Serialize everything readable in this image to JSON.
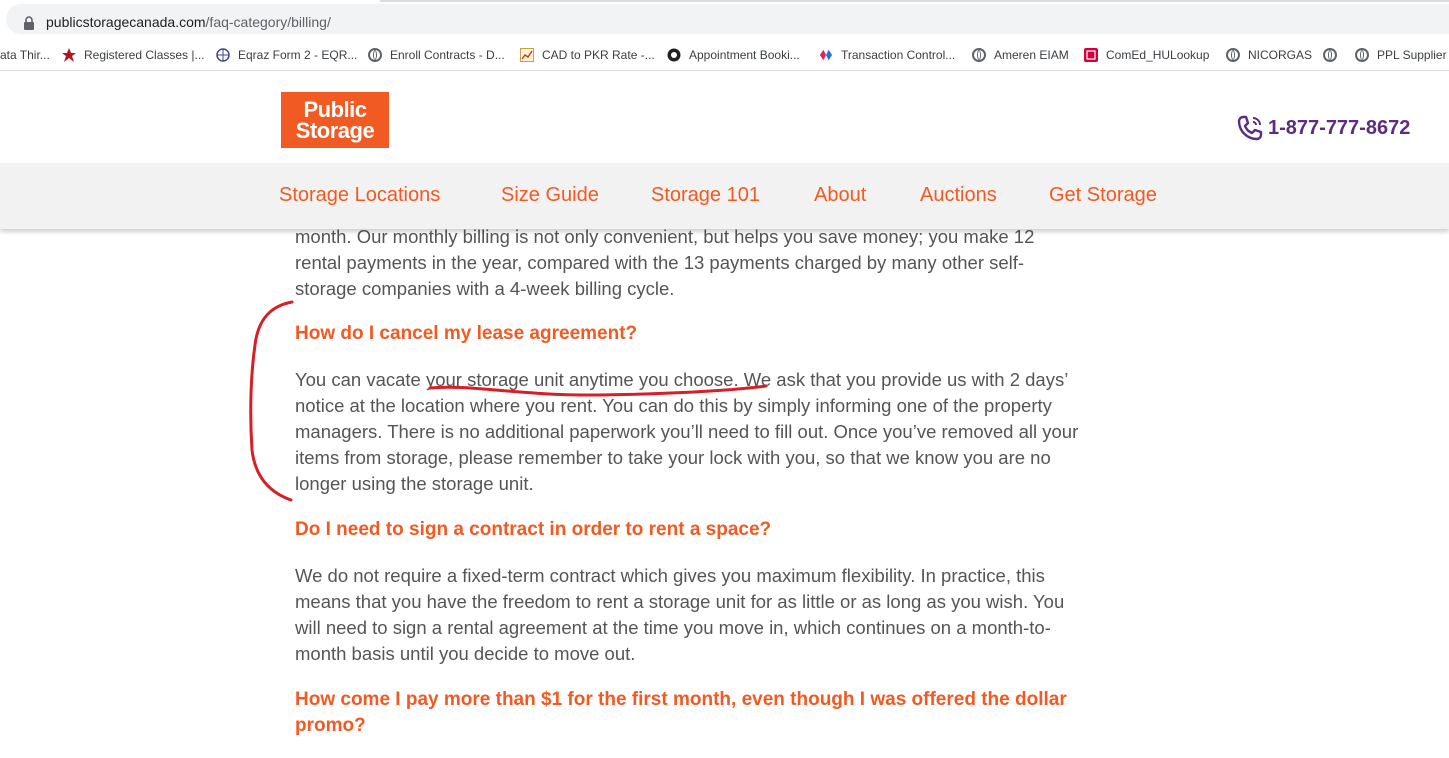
{
  "browser": {
    "url_domain": "publicstoragecanada.com",
    "url_path": "/faq-category/billing/",
    "bookmarks": [
      {
        "label": "ata Thir...",
        "icon": "none"
      },
      {
        "label": "Registered Classes |...",
        "icon": "star-red-icon"
      },
      {
        "label": "Eqraz Form 2 - EQR...",
        "icon": "globe-blue-icon"
      },
      {
        "label": "Enroll Contracts - D...",
        "icon": "globe-icon"
      },
      {
        "label": "CAD to PKR Rate -...",
        "icon": "chart-icon"
      },
      {
        "label": "Appointment Booki...",
        "icon": "circle-dot-icon"
      },
      {
        "label": "Transaction Control...",
        "icon": "diamond-icon"
      },
      {
        "label": "Ameren EIAM",
        "icon": "globe-icon"
      },
      {
        "label": "ComEd_HULookup",
        "icon": "red-square-icon"
      },
      {
        "label": "NICORGAS",
        "icon": "globe-icon"
      },
      {
        "label": "",
        "icon": "globe-icon"
      },
      {
        "label": "PPL Supplier I",
        "icon": "globe-icon"
      }
    ]
  },
  "header": {
    "logo_line1": "Public",
    "logo_line2": "Storage",
    "phone": "1-877-777-8672"
  },
  "nav": {
    "items": [
      "Storage Locations",
      "Size Guide",
      "Storage 101",
      "About",
      "Auctions",
      "Get Storage"
    ]
  },
  "content": {
    "intro_lines": [
      "month. Our monthly billing is not only convenient, but helps you save money; you make 12",
      "rental payments in the year, compared with the 13 payments charged by many other self-",
      "storage companies with a 4-week billing cycle."
    ],
    "faq": [
      {
        "question": "How do I cancel my lease agreement?",
        "answer_lines": [
          "You can vacate your storage unit anytime you choose. We ask that you provide us with 2 days’",
          "notice at the location where you rent. You can do this by simply informing one of the property",
          "managers. There is no additional paperwork you’ll need to fill out. Once you’ve removed all your",
          "items from storage, please remember to take your lock with you, so that we know you are no",
          "longer using the storage unit."
        ]
      },
      {
        "question": "Do I need to sign a contract in order to rent a space?",
        "answer_lines": [
          "We do not require a fixed-term contract which gives you maximum flexibility. In practice, this",
          "means that you have the freedom to rent a storage unit for as little or as long as you wish. You",
          "will need to sign a rental agreement at the time you move in, which continues on a month-to-",
          "month basis until you decide to move out."
        ]
      },
      {
        "question_lines": [
          "How come I pay more than $1 for the first month, even though I was offered the dollar",
          "promo?"
        ]
      }
    ]
  },
  "colors": {
    "brand_orange": "#f15a22",
    "phone_purple": "#5b2c83",
    "body_text": "#555555",
    "annotation_red": "#d61f26"
  }
}
